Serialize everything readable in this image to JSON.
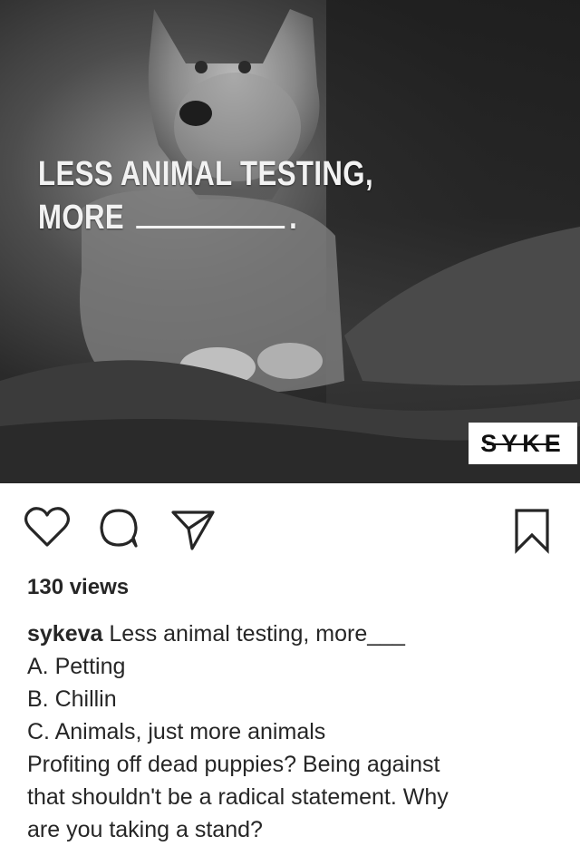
{
  "post": {
    "image_text": {
      "line1": "LESS ANIMAL TESTING,",
      "line2": "MORE",
      "punct": "."
    },
    "logo_text": "SYKE",
    "views": "130 views",
    "username": "sykeva",
    "caption_first": "Less animal testing, more___",
    "options": [
      "A. Petting",
      "B. Chillin",
      "C. Animals, just more animals"
    ],
    "body_lines": [
      "Profiting off dead puppies? Being against",
      "that shouldn't be a radical statement. Why",
      "are you taking a stand?"
    ]
  },
  "icons": {
    "like": "heart-icon",
    "comment": "comment-icon",
    "share": "paper-plane-icon",
    "save": "bookmark-icon"
  }
}
